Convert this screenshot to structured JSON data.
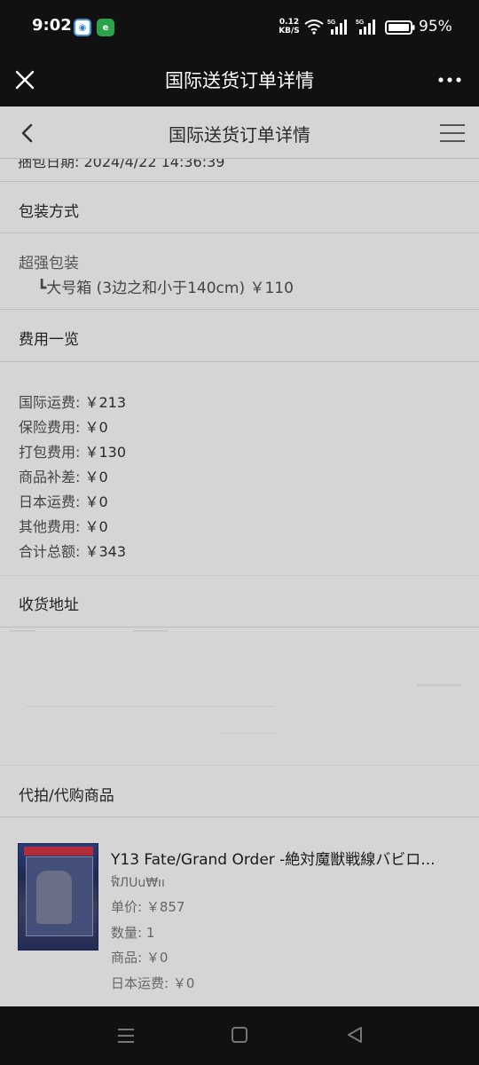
{
  "status_bar": {
    "time": "9:02",
    "net_speed_value": "0.12",
    "net_speed_unit": "KB/S",
    "battery": "95%"
  },
  "top_nav": {
    "title": "国际送货订单详情"
  },
  "sub_header": {
    "title": "国际送货订单详情"
  },
  "order": {
    "cut_off_line": "捆包日期: 2024/4/22 14:36:39",
    "packaging_section": "包装方式",
    "packaging_name": "超强包装",
    "packaging_detail": "┗大号箱 (3边之和小于140cm)   ￥110",
    "fees_section": "费用一览",
    "fees": [
      {
        "label": "国际运费:",
        "value": "￥213"
      },
      {
        "label": "保险费用:",
        "value": "￥0"
      },
      {
        "label": "打包费用:",
        "value": "￥130"
      },
      {
        "label": "商品补差:",
        "value": "￥0"
      },
      {
        "label": "日本运费:",
        "value": "￥0"
      },
      {
        "label": "其他费用:",
        "value": "￥0"
      },
      {
        "label": "合计总额:",
        "value": "￥343"
      }
    ],
    "address_section": "收货地址",
    "goods_section": "代拍/代购商品",
    "product": {
      "title": "Y13    Fate/Grand Order -絶対魔獣戦線バビロ...",
      "sub": "ฬ็ЛUu₩ıı",
      "unit_price": "单价: ￥857",
      "quantity": "数量: 1",
      "goods_fee": "商品: ￥0",
      "jp_shipping": "日本运费: ￥0"
    }
  }
}
